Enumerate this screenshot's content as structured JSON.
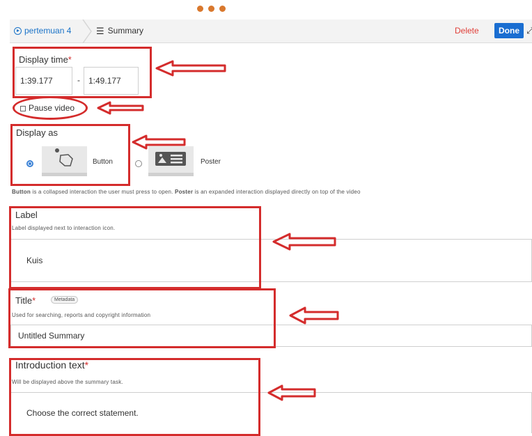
{
  "header": {
    "breadcrumb_root": "pertemuan 4",
    "breadcrumb_current": "Summary",
    "delete_label": "Delete",
    "done_label": "Done"
  },
  "display_time": {
    "label": "Display time",
    "required_mark": "*",
    "start": "1:39.177",
    "separator": "-",
    "end": "1:49.177"
  },
  "pause_video": {
    "label": "Pause video",
    "checked": false
  },
  "display_as": {
    "label": "Display as",
    "options": [
      {
        "label": "Button",
        "selected": true
      },
      {
        "label": "Poster",
        "selected": false
      }
    ],
    "help_button_term": "Button",
    "help_text_1": " is a collapsed interaction the user must press to open. ",
    "help_poster_term": "Poster",
    "help_text_2": " is an expanded interaction displayed directly on top of the video"
  },
  "label_field": {
    "label": "Label",
    "description": "Label displayed next to interaction icon.",
    "value": "Kuis"
  },
  "title_field": {
    "label": "Title",
    "required_mark": "*",
    "badge": "Metadata",
    "description": "Used for searching, reports and copyright information",
    "value": "Untitled Summary"
  },
  "intro_field": {
    "label": "Introduction text",
    "required_mark": "*",
    "description": "Will be displayed above the summary task.",
    "value": "Choose the correct statement."
  },
  "colors": {
    "annotation_red": "#d42c2c",
    "accent_blue": "#1a6ed1",
    "delete_red": "#e0403a",
    "dots_orange": "#d9782d"
  }
}
